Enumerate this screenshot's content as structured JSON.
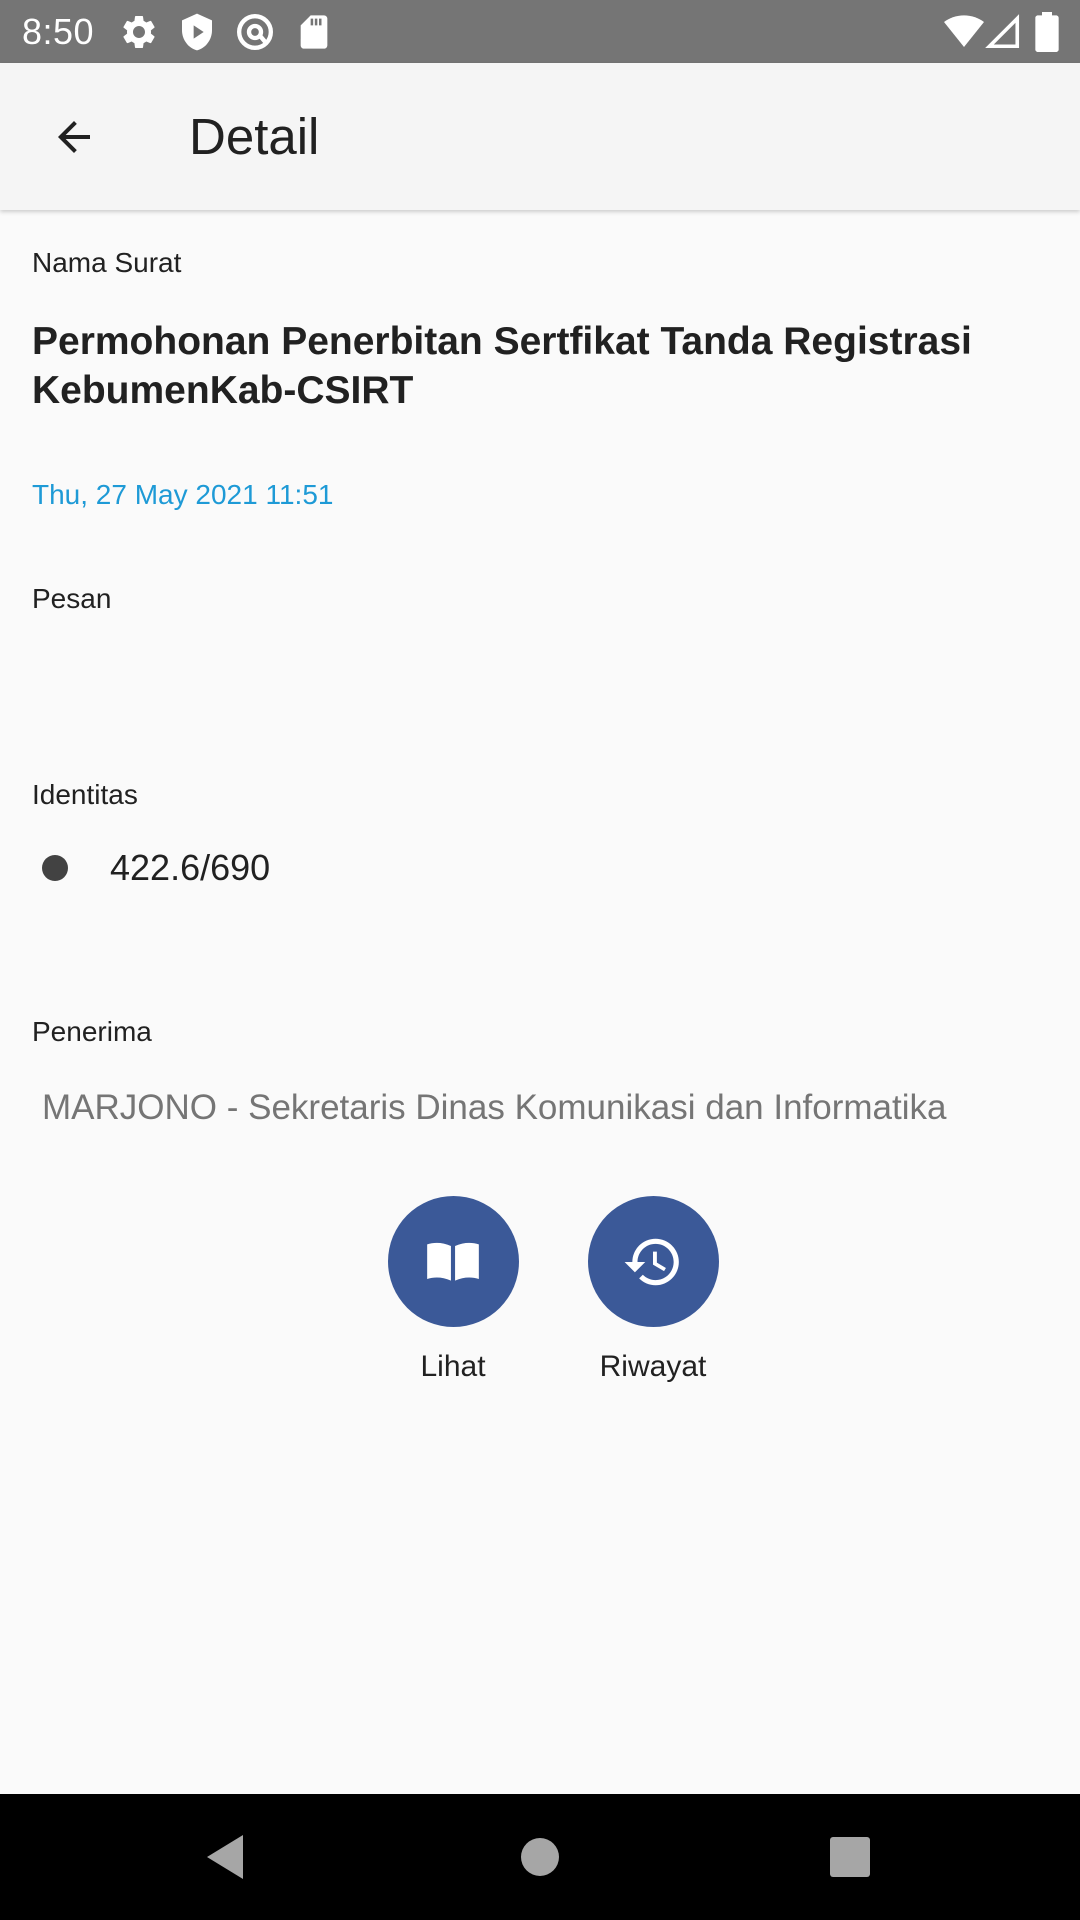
{
  "status_bar": {
    "time": "8:50",
    "icons": [
      "gear-icon",
      "shield-icon",
      "at-sign-icon",
      "sd-card-icon",
      "wifi-icon",
      "signal-icon",
      "battery-icon"
    ]
  },
  "app_bar": {
    "back_icon": "arrow-left-icon",
    "title": "Detail"
  },
  "detail": {
    "name_label": "Nama Surat",
    "name_value": "Permohonan Penerbitan Sertfikat Tanda Registrasi KebumenKab-CSIRT",
    "date": "Thu, 27 May 2021 11:51",
    "message_label": "Pesan",
    "message_value": "",
    "identity_label": "Identitas",
    "identity_items": [
      "422.6/690"
    ],
    "recipient_label": "Penerima",
    "recipient_value": "MARJONO - Sekretaris Dinas Komunikasi dan Informatika"
  },
  "actions": [
    {
      "label": "Lihat",
      "icon": "open-book-icon"
    },
    {
      "label": "Riwayat",
      "icon": "history-icon"
    }
  ],
  "nav_bar": {
    "buttons": [
      "back-triangle-icon",
      "home-circle-icon",
      "recents-square-icon"
    ]
  },
  "colors": {
    "status_bar": "#757575",
    "app_bar": "#f5f5f5",
    "background": "#fafafa",
    "date_accent": "#1e9ad6",
    "action_button": "#3b5998",
    "nav_bar": "#000000"
  }
}
